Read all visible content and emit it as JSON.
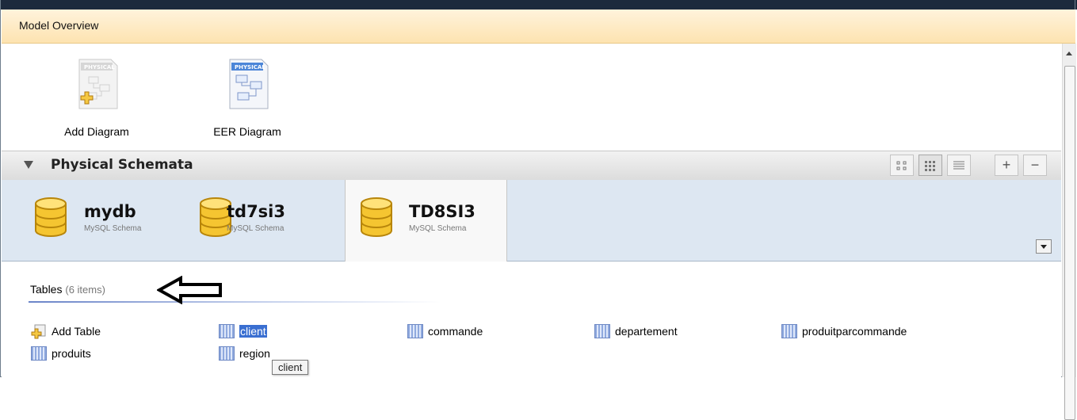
{
  "window": {
    "title": "Model Overview"
  },
  "diagrams": [
    {
      "label": "Add Diagram",
      "tag": "PHYSICAL",
      "icon": "add-diagram-icon"
    },
    {
      "label": "EER Diagram",
      "tag": "PHYSICAL",
      "icon": "eer-diagram-icon"
    }
  ],
  "schemata": {
    "title": "Physical Schemata",
    "view_buttons": [
      "small-icons-view",
      "medium-icons-view",
      "list-view"
    ],
    "add_label": "+",
    "remove_label": "−",
    "tabs": [
      {
        "name": "mydb",
        "subtitle": "MySQL Schema"
      },
      {
        "name": "td7si3",
        "subtitle": "MySQL Schema"
      },
      {
        "name": "TD8SI3",
        "subtitle": "MySQL Schema",
        "active": true
      }
    ]
  },
  "tables": {
    "label": "Tables",
    "count": "(6 items)",
    "add_label": "Add Table",
    "items": [
      "client",
      "commande",
      "departement",
      "produitparcommande",
      "produits",
      "region"
    ],
    "selected": "client"
  },
  "tooltip": "client"
}
